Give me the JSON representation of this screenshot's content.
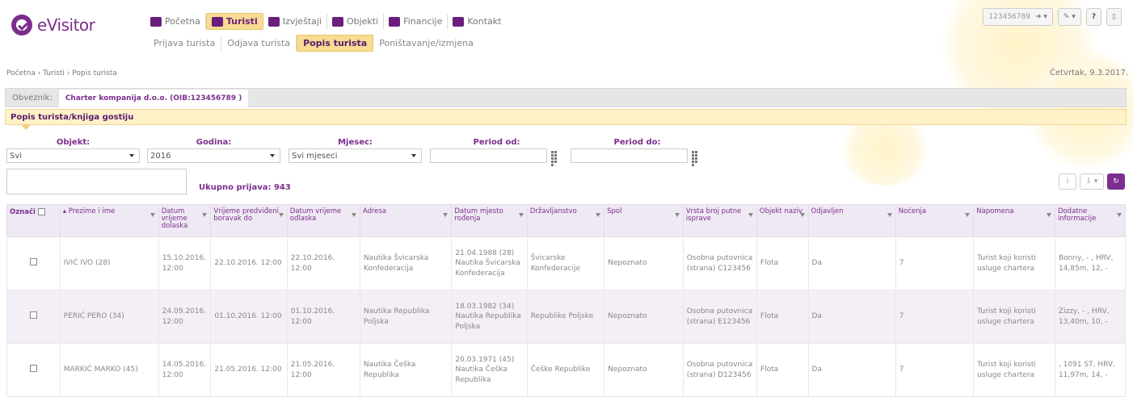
{
  "app": {
    "logo_text": "eVisitor"
  },
  "nav": {
    "items": [
      {
        "label": "Početna",
        "icon": "home-icon",
        "active": false
      },
      {
        "label": "Turisti",
        "icon": "users-icon",
        "active": true
      },
      {
        "label": "Izvještaji",
        "icon": "chart-icon",
        "active": false
      },
      {
        "label": "Objekti",
        "icon": "bed-icon",
        "active": false
      },
      {
        "label": "Financije",
        "icon": "money-icon",
        "active": false
      },
      {
        "label": "Kontakt",
        "icon": "mail-icon",
        "active": false
      }
    ]
  },
  "subnav": {
    "items": [
      {
        "label": "Prijava turista",
        "active": false
      },
      {
        "label": "Odjava turista",
        "active": false
      },
      {
        "label": "Popis turista",
        "active": true
      },
      {
        "label": "Poništavanje/izmjena",
        "active": false
      }
    ]
  },
  "user": {
    "id": "123456789"
  },
  "breadcrumb": "Početna › Turisti › Popis turista",
  "date": "Četvrtak, 9.3.2017.",
  "obveznik": {
    "label": "Obveznik:",
    "value": "Charter kompanija d.o.o. (OIB:123456789 )"
  },
  "section_title": "Popis turista/knjiga gostiju",
  "filters": {
    "objekt": {
      "label": "Objekt:",
      "value": "Svi"
    },
    "godina": {
      "label": "Godina:",
      "value": "2016"
    },
    "mjesec": {
      "label": "Mjesec:",
      "value": "Svi mjeseci"
    },
    "period_od": {
      "label": "Period od:",
      "value": ""
    },
    "period_do": {
      "label": "Period do:",
      "value": ""
    }
  },
  "total": "Ukupno prijava: 943",
  "table": {
    "headers": [
      "Označi",
      "Prezime i ime",
      "Datum vrijeme dolaska",
      "Vrijeme predviđeni boravak do",
      "Datum vrijeme odlaska",
      "Adresa",
      "Datum mjesto rođenja",
      "Državljanstvo",
      "Spol",
      "Vrsta broj putne isprave",
      "Objekt naziv",
      "Odjavljen",
      "Noćenja",
      "Napomena",
      "Dodatne informacije"
    ],
    "rows": [
      {
        "name": "IVIĆ IVO (28)",
        "dolazak": "15.10.2016. 12:00",
        "boravak": "22.10.2016. 12:00",
        "odlazak": "22.10.2016. 12:00",
        "adresa": "Nautika Švicarska Konfederacija",
        "rodjenje": "21.04.1988 (28) Nautika Švicarska Konfederacija",
        "drzavljanstvo": "Švicarske Konfederacije",
        "spol": "Nepoznato",
        "isprava": "Osobna putovnica (strana) C123456",
        "objekt": "Flota",
        "odjavljen": "Da",
        "nocenja": "7",
        "napomena": "Turist koji koristi usluge chartera",
        "dodatno": "Bonny, - , HRV, 14,85m, 12, -"
      },
      {
        "name": "PERIĆ PERO (34)",
        "dolazak": "24.09.2016. 12:00",
        "boravak": "01.10.2016. 12:00",
        "odlazak": "01.10.2016. 12:00",
        "adresa": "Nautika Republika Poljska",
        "rodjenje": "18.03.1982 (34) Nautika Republika Poljska",
        "drzavljanstvo": "Republike Poljske",
        "spol": "Nepoznato",
        "isprava": "Osobna putovnica (strana) E123456",
        "objekt": "Flota",
        "odjavljen": "Da",
        "nocenja": "7",
        "napomena": "Turist koji koristi usluge chartera",
        "dodatno": "Zizzy, - , HRV, 13,40m, 10, -"
      },
      {
        "name": "MARKIĆ MARKO (45)",
        "dolazak": "14.05.2016. 12:00",
        "boravak": "21.05.2016. 12:00",
        "odlazak": "21.05.2016. 12:00",
        "adresa": "Nautika Češka Republika",
        "rodjenje": "20.03.1971 (45) Nautika Češka Republika",
        "drzavljanstvo": "Češke Republike",
        "spol": "Nepoznato",
        "isprava": "Osobna putovnica (strana) D123456",
        "objekt": "Flota",
        "odjavljen": "Da",
        "nocenja": "7",
        "napomena": "Turist koji koristi usluge chartera",
        "dodatno": ", 1091 ST, HRV, 11,97m, 14, -"
      }
    ]
  },
  "colors": {
    "brand": "#7b2e8e",
    "highlight": "#f7dc91"
  }
}
